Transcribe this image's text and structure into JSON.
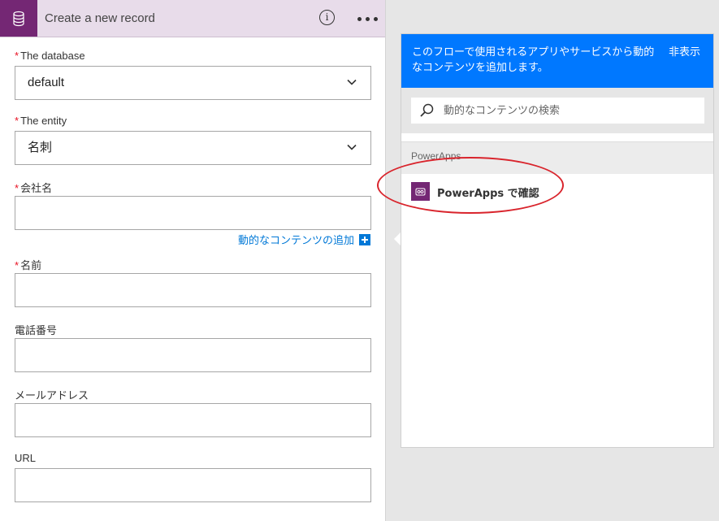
{
  "card": {
    "title": "Create a new record",
    "info_glyph": "i",
    "icon": "database-icon"
  },
  "fields": {
    "database": {
      "label": "The database",
      "value": "default"
    },
    "entity": {
      "label": "The entity",
      "value": "名刺"
    },
    "company": {
      "label": "会社名",
      "value": ""
    },
    "name": {
      "label": "名前",
      "value": ""
    },
    "phone": {
      "label": "電話番号",
      "value": ""
    },
    "email": {
      "label": "メールアドレス",
      "value": ""
    },
    "url": {
      "label": "URL",
      "value": ""
    }
  },
  "required_mark": "*",
  "add_dynamic_content": "動的なコンテンツの追加",
  "panel": {
    "description": "このフローで使用されるアプリやサービスから動的なコンテンツを追加します。",
    "hide": "非表示",
    "search_placeholder": "動的なコンテンツの検索",
    "section": "PowerApps",
    "items": [
      {
        "label": "PowerApps で確認",
        "icon": "powerapps-icon"
      }
    ]
  },
  "colors": {
    "accent_purple": "#742774",
    "header_tint": "#e8dcea",
    "panel_blue": "#0078ff",
    "link_blue": "#0078d7",
    "required_red": "#e81123",
    "annotation_red": "#d9242c"
  }
}
